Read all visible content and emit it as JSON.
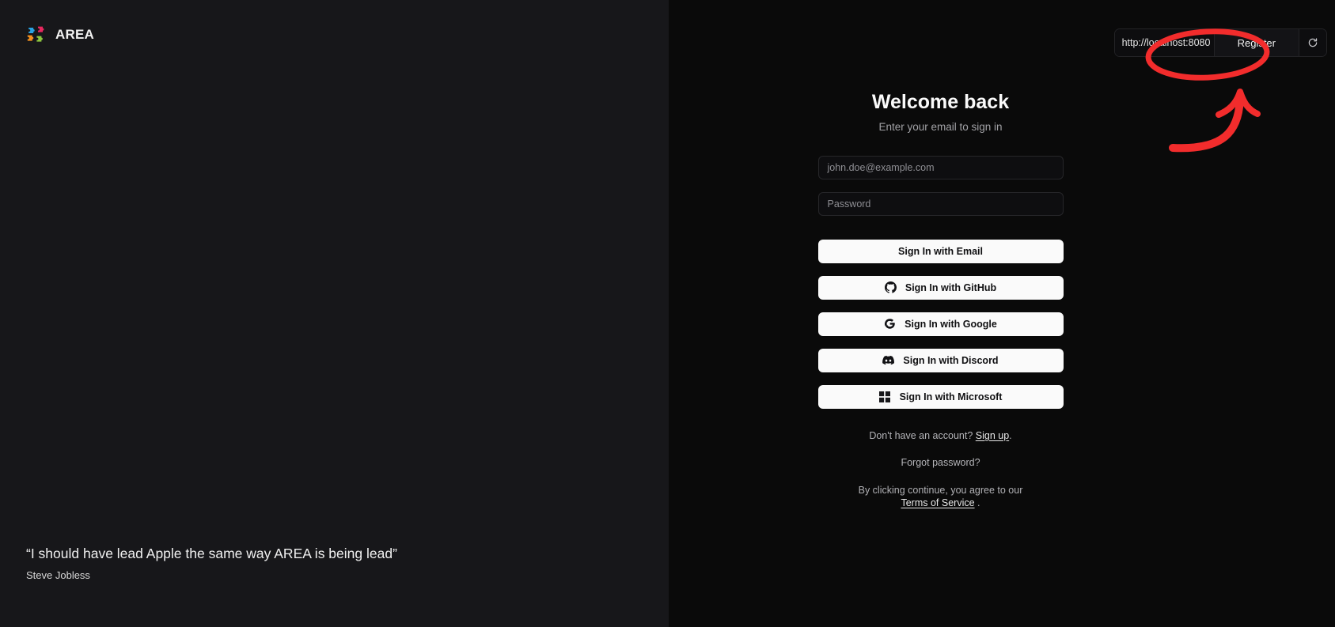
{
  "brand": {
    "name": "AREA",
    "logo_icon": "puzzle-pieces-icon",
    "logo_colors": [
      "#2196f3",
      "#e91e63",
      "#ff9800",
      "#8bc34a"
    ]
  },
  "left_panel": {
    "quote": "“I should have lead Apple the same way AREA is being lead”",
    "author": "Steve Jobless"
  },
  "toolbar": {
    "url_value": "http://localhost:8080",
    "register_label": "Register",
    "refresh_icon": "refresh-icon"
  },
  "login": {
    "title": "Welcome back",
    "subtitle": "Enter your email to sign in",
    "email_placeholder": "john.doe@example.com",
    "email_value": "",
    "password_placeholder": "Password",
    "password_value": "",
    "buttons": [
      {
        "label": "Sign In with Email",
        "icon": "none"
      },
      {
        "label": "Sign In with GitHub",
        "icon": "github-icon"
      },
      {
        "label": "Sign In with Google",
        "icon": "google-icon"
      },
      {
        "label": "Sign In with Discord",
        "icon": "discord-icon"
      },
      {
        "label": "Sign In with Microsoft",
        "icon": "microsoft-icon"
      }
    ],
    "signup_prompt": "Don't have an account?",
    "signup_link": "Sign up",
    "signup_period": ".",
    "forgot_password": "Forgot password?",
    "terms_prefix": "By clicking continue, you agree to our",
    "terms_link": "Terms of Service",
    "terms_suffix": "."
  },
  "annotation": {
    "color": "#f22c2c",
    "shapes": [
      "ellipse-around-register-button",
      "curved-arrow-pointing-up"
    ]
  },
  "theme": {
    "left_bg": "#17171a",
    "right_bg": "#0a0a0a",
    "button_bg": "#fafafa",
    "text_primary": "#fafafa",
    "text_muted": "#a2a2a6"
  }
}
